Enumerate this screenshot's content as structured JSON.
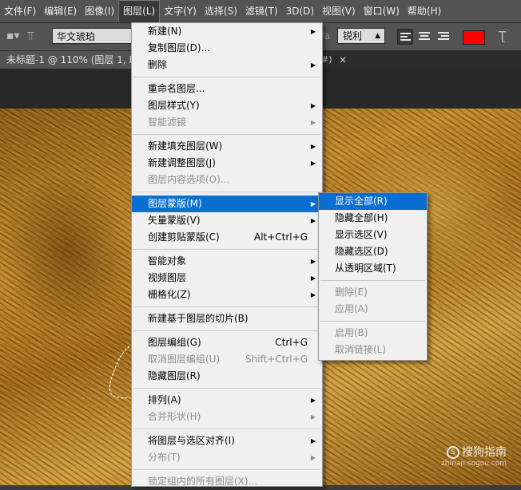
{
  "menubar": {
    "items": [
      "文件(F)",
      "编辑(E)",
      "图像(I)",
      "图层(L)",
      "文字(Y)",
      "选择(S)",
      "滤镜(T)",
      "3D(D)",
      "视图(V)",
      "窗口(W)",
      "帮助(H)"
    ]
  },
  "options": {
    "font_family": "华文琥珀",
    "antialias": "锐利",
    "text_color": "#ff0000"
  },
  "tab": {
    "title": "未标题-1 @ 110% (图层 1, R",
    "title2": "#)",
    "close": "×"
  },
  "layer_menu": {
    "items": [
      {
        "label": "新建(N)",
        "submenu": true
      },
      {
        "label": "复制图层(D)..."
      },
      {
        "label": "删除",
        "submenu": true
      },
      {
        "separator": true
      },
      {
        "label": "重命名图层..."
      },
      {
        "label": "图层样式(Y)",
        "submenu": true
      },
      {
        "label": "智能滤镜",
        "submenu": true,
        "disabled": true
      },
      {
        "separator": true
      },
      {
        "label": "新建填充图层(W)",
        "submenu": true
      },
      {
        "label": "新建调整图层(J)",
        "submenu": true
      },
      {
        "label": "图层内容选项(O)...",
        "disabled": true
      },
      {
        "separator": true
      },
      {
        "label": "图层蒙版(M)",
        "submenu": true,
        "highlighted": true
      },
      {
        "label": "矢量蒙版(V)",
        "submenu": true
      },
      {
        "label": "创建剪贴蒙版(C)",
        "shortcut": "Alt+Ctrl+G"
      },
      {
        "separator": true
      },
      {
        "label": "智能对象",
        "submenu": true
      },
      {
        "label": "视频图层",
        "submenu": true
      },
      {
        "label": "栅格化(Z)",
        "submenu": true
      },
      {
        "separator": true
      },
      {
        "label": "新建基于图层的切片(B)"
      },
      {
        "separator": true
      },
      {
        "label": "图层编组(G)",
        "shortcut": "Ctrl+G"
      },
      {
        "label": "取消图层编组(U)",
        "shortcut": "Shift+Ctrl+G",
        "disabled": true
      },
      {
        "label": "隐藏图层(R)"
      },
      {
        "separator": true
      },
      {
        "label": "排列(A)",
        "submenu": true
      },
      {
        "label": "合并形状(H)",
        "submenu": true,
        "disabled": true
      },
      {
        "separator": true
      },
      {
        "label": "将图层与选区对齐(I)",
        "submenu": true
      },
      {
        "label": "分布(T)",
        "submenu": true,
        "disabled": true
      },
      {
        "separator": true
      },
      {
        "label": "锁定组内的所有图层(X)...",
        "disabled": true
      }
    ]
  },
  "mask_submenu": {
    "items": [
      {
        "label": "显示全部(R)",
        "highlighted": true
      },
      {
        "label": "隐藏全部(H)"
      },
      {
        "label": "显示选区(V)"
      },
      {
        "label": "隐藏选区(D)"
      },
      {
        "label": "从透明区域(T)"
      },
      {
        "separator": true
      },
      {
        "label": "删除(E)",
        "disabled": true
      },
      {
        "label": "应用(A)",
        "disabled": true
      },
      {
        "separator": true
      },
      {
        "label": "启用(B)",
        "disabled": true
      },
      {
        "label": "取消链接(L)",
        "disabled": true
      }
    ]
  },
  "watermark": {
    "brand": "搜狗指南",
    "icon_letter": "S",
    "url": "zhinan.sogou.com"
  }
}
